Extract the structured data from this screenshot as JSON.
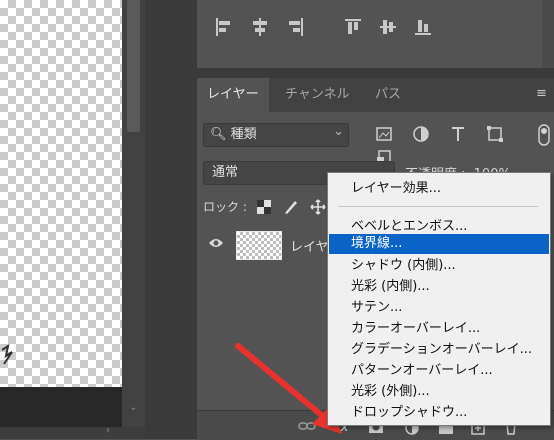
{
  "tabs": [
    "レイヤー",
    "チャンネル",
    "パス"
  ],
  "filter": {
    "label": "種類",
    "chevron": "⌄"
  },
  "blend_mode": "通常",
  "opacity": {
    "label": "不透明度 :",
    "value": "100%"
  },
  "lock": {
    "label": "ロック :"
  },
  "layer": {
    "name": "レイヤ"
  },
  "icons": {
    "filter_icons": [
      "image-icon",
      "adjustment-icon",
      "type-icon",
      "shape-icon",
      "smart-object-icon"
    ],
    "bottom_icons": [
      "link-icon",
      "fx-icon",
      "mask-icon",
      "adjustment-layer-icon",
      "group-icon",
      "new-layer-icon",
      "trash-icon"
    ]
  },
  "context_menu": {
    "items": [
      "レイヤー効果...",
      "ベベルとエンボス...",
      "境界線...",
      "シャドウ (内側)...",
      "光彩 (内側)...",
      "サテン...",
      "カラーオーバーレイ...",
      "グラデーションオーバーレイ...",
      "パターンオーバーレイ...",
      "光彩 (外側)...",
      "ドロップシャドウ..."
    ],
    "selected": "境界線..."
  },
  "colors": {
    "accent": "#0a64c8",
    "panel": "#535353",
    "dark": "#3a3a3a",
    "arrow": "#e8322d"
  }
}
